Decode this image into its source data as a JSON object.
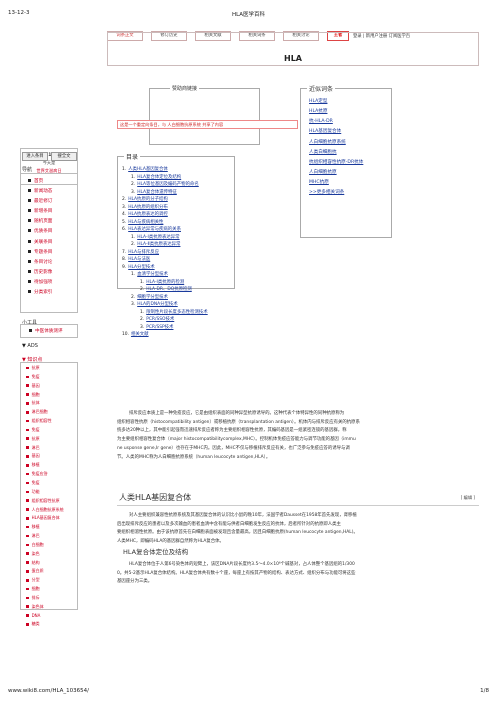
{
  "print_header": {
    "date": "13-12-3",
    "title": "HLA医学百科"
  },
  "print_footer": {
    "url": "www.wiki8.com/HLA_103654/",
    "page": "1/8"
  },
  "tabs": [
    "词条正文",
    "修订历史",
    "相关文献",
    "相关词条",
    "相关讨论",
    "王者"
  ],
  "top_right": "登录 | 新用户注册  订阅医学百",
  "article_title": "HLA",
  "left": {
    "date": "2013年12月3日",
    "weekday": "今天是",
    "site": "世界艾滋病日",
    "search_label": "搜索",
    "enter_btn": "进入条目",
    "search_btn": "搜全文",
    "nav_label": "导航",
    "nav_items": [
      "首页",
      "新闻动态",
      "最近修订",
      "新增条目",
      "随机页面",
      "优质条目",
      "关联条目",
      "专题条目",
      "条目讨论",
      "历史影像",
      "待加强项",
      "分类索引"
    ],
    "tools_label": "小工具",
    "tool_item": "中医体质测评",
    "ads_label": "▼ ADS",
    "know_label": "▼ 知识点",
    "know_items": [
      "抗原",
      "免疫",
      "基因",
      "细胞",
      "抗体",
      "淋巴细胞",
      "组织相容性",
      "免疫",
      "抗原",
      "淋巴",
      "基因",
      "移植",
      "免疫应答",
      "免疫",
      "功能",
      "组织相容性抗原",
      "人白细胞抗原系统",
      "HLA基因复合体",
      "移植",
      "淋巴",
      "白细胞",
      "染色",
      "结构",
      "蛋白质",
      "分型",
      "细胞",
      "排斥",
      "染色体",
      "DNA",
      "糖类"
    ]
  },
  "sponsor_label": "赞助商链接",
  "red_bar": "这是一个重定向条目，与 人白细胞抗原系统 共享了内容",
  "near_label": "近似词条",
  "near_items": [
    "HLA定型",
    "HLA抗原",
    "抗-HLA-DR",
    "HLA基因复合体",
    "人白细胞抗原系统",
    "人类白细胞抗",
    "抗组织相容性抗原-DR抗体",
    "人白细胞抗原",
    "MHC抗原",
    ">>更多相关词条"
  ],
  "toc_label": "目录",
  "toc": [
    {
      "n": "1.",
      "t": "人类HLA基因复合体",
      "indent": 0
    },
    {
      "n": "1.",
      "t": "HLA复合体定位及结构",
      "indent": 1
    },
    {
      "n": "2.",
      "t": "HLA等位基因及编码产物的命名",
      "indent": 1
    },
    {
      "n": "3.",
      "t": "HLA复合体遗传特征",
      "indent": 1
    },
    {
      "n": "2.",
      "t": "HLA抗原的分子结构",
      "indent": 0
    },
    {
      "n": "3.",
      "t": "HLA抗原的组织分布",
      "indent": 0
    },
    {
      "n": "4.",
      "t": "HLA抗原表达的调控",
      "indent": 0
    },
    {
      "n": "5.",
      "t": "HLA与疾病相关性",
      "indent": 0
    },
    {
      "n": "6.",
      "t": "HLA表达异常与疾病的关系",
      "indent": 0
    },
    {
      "n": "1.",
      "t": "HLA-Ⅰ类抗原表达异常",
      "indent": 1
    },
    {
      "n": "2.",
      "t": "HLA-Ⅱ类抗原表达异常",
      "indent": 1
    },
    {
      "n": "7.",
      "t": "HLA与排斥反应",
      "indent": 0
    },
    {
      "n": "8.",
      "t": "HLA与法医",
      "indent": 0
    },
    {
      "n": "9.",
      "t": "HLA分型技术",
      "indent": 0
    },
    {
      "n": "1.",
      "t": "血清学分型技术",
      "indent": 1
    },
    {
      "n": "1.",
      "t": "HLA-Ⅰ类抗原的检测",
      "indent": 2
    },
    {
      "n": "2.",
      "t": "HLA-DR、DQ抗原检测",
      "indent": 2
    },
    {
      "n": "2.",
      "t": "细胞学分型技术",
      "indent": 1
    },
    {
      "n": "3.",
      "t": "HLA的DNA分型技术",
      "indent": 1
    },
    {
      "n": "1.",
      "t": "限制性片段长度多态性检测技术",
      "indent": 2
    },
    {
      "n": "2.",
      "t": "PCR/SSO技术",
      "indent": 2
    },
    {
      "n": "3.",
      "t": "PCR/SSP技术",
      "indent": 2
    },
    {
      "n": "10.",
      "t": "相关文献",
      "indent": 0
    }
  ],
  "intro_lines": [
    "排斥反应本质上是一种免疫反应，它是由组织表面的同种异型抗原诱导的。这种代表个体特异性的同种抗原称为",
    "组织相容性抗原（histocompatibility antigen）或移植抗原（transplantation antigen）。机体内与排斥反应有关的抗原系",
    "统多达20种以上，其中能引起强而迅速排斥反应者称为主要组织相容性抗原，其编码基因是一组紧密连锁的基因群，称",
    "为主要组织相容性复合体（major histocompatibilitycomplex,MHC）。控制机体免疫应答能力与调节功能的基因（immu",
    "ne usponse gene,Ir gene）也存在于MHC内。因此，MHC不仅与移植排斥反应有关，也广泛参与免疫应答的诱导与调",
    "节。人类的MHC称为人白细胞抗原系统（human leucocyte antigen,HLA）。"
  ],
  "section": {
    "title": "人类HLA基因复合体",
    "edit": "[ 编辑 ]"
  },
  "section_lines": [
    "对人主要组织兼容性抗原系统及其基因复合体的认识比小鼠的晚10年，法国学者Dausset在1958年首先发现，肾移植",
    "后出现排斥反应的患者以及多次输血的患者血清中含有能与供者白细胞发生反应的抗体，后者所针对的抗原即人类主",
    "要组织相溶性抗原。由于该抗原首先在白细胞表面被发现且含量最高，因且白细胞抗原(human leucocyte antigen,HAL)。",
    "人类MHC，即编码HLA的基因群自然称为HLA复合体。"
  ],
  "sub": {
    "title": "HLA复合体定位及结构"
  },
  "sub_lines": [
    "HLA复合体位于人第6号染色体的短臂上，该区DNA片段长度约3.5～4.0×10⁶个碱基对，占人体整个基因组的1/300",
    "0。共5-2基示HLA复合体结构。HLA复合体共有数十个座，每座上有按其产物的结构、表达方式、组织分布与功能可将这些",
    "基因座分为三类。"
  ]
}
